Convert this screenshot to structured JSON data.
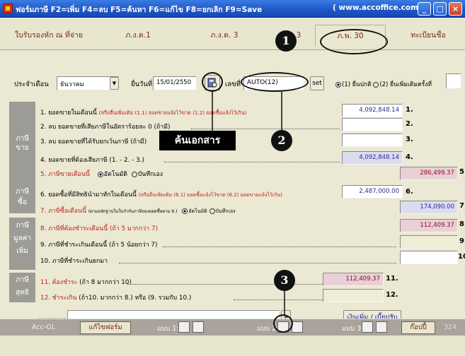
{
  "window": {
    "title": "ฟอร์มภาษี  F2=เพิ่ม F4=ลบ F5=ค้นหา F6=แก้ไข F8=ยกเลิก F9=Save",
    "url": "( www.accoffice.com )",
    "min": "_",
    "max": "□",
    "close": "×"
  },
  "tabs": [
    {
      "label": "ใบรับรองหัก ณ ที่จ่าย"
    },
    {
      "label": "ภ.ง.ด.1"
    },
    {
      "label": "ภ.ง.ด. 3"
    },
    {
      "label": "3"
    },
    {
      "label": "ภ.พ. 30"
    },
    {
      "label": "ทะเบียนชื่อ"
    }
  ],
  "header": {
    "month_label": "ประจำเดือน",
    "month_value": "ธันวาคม",
    "date_label": "ยื่นวันที่",
    "date_value": "15/01/2550",
    "no_label": "เลขที่",
    "no_value": "AUTO(12)",
    "set_label": "set",
    "filing_normal": "(1) ยื่นปกติ",
    "filing_extra": "(2) ยื่นเพิ่มเติมครั้งที่"
  },
  "sections": {
    "sales": "ภาษี\nขาย",
    "purchase": "ภาษี\nซื้อ",
    "vat": "ภาษี\nมูลค่า\nเพิ่ม",
    "net": "ภาษี\nสุทธิ"
  },
  "rows": {
    "r1": "1. ยอดขายในเดือนนี้",
    "r1_note": "(หรือยื่นเพิ่มเติม (1.1) ยอดขายแจ้งไว้ขาด (1.2) ยอดซื้อแจ้งไว้เกิน)",
    "r1_val": "4,092,848.14",
    "r1_no": "1.",
    "r2": "2. ลบ ยอดขายที่เสียภาษีในอัตราร้อยละ 0 (ถ้ามี)",
    "r2_no": "2.",
    "r3": "3. ลบ ยอดขายที่ได้รับยกเว้นภาษี (ถ้ามี)",
    "r3_no": "3.",
    "r4": "4. ยอดขายที่ต้องเสียภาษี (1. - 2. - 3.)",
    "r4_val": "4,092,848.14",
    "r4_no": "4.",
    "r5": "5. ภาษีขายเดือนนี้",
    "r5_auto": "อัตโนมัติ",
    "r5_manual": "บันทึกเอง",
    "r5_val": "286,499.37",
    "r5_no": "5.",
    "r6": "6. ยอดซื้อที่มีสิทธินำมาหักในเดือนนี้",
    "r6_note": "(หรือยื่นเพิ่มเติม (6.1) ยอดซื้อแจ้งไว้ขาด (6.2) ยอดขายแจ้งไว้เกิน)",
    "r6_val": "2,487,000.00",
    "r6_no": "6.",
    "r7": "7. ภาษีซื้อเดือนนี้",
    "r7_note": "(ตามหลักฐานในใบกำกับภาษีของยอดซื้อตาม 6.)",
    "r7_auto": "อัตโนมัติ",
    "r7_manual": "บันทึกเอง",
    "r7_val": "174,090.00",
    "r7_no": "7.",
    "r8": "8. ภาษีที่ต้องชำระเดือนนี้ (ถ้า 5 มากกว่า 7)",
    "r8_val": "112,409.37",
    "r8_no": "8.",
    "r9": "9. ภาษีที่ชำระเกินเดือนนี้ (ถ้า 5 น้อยกว่า 7)",
    "r9_no": "9.",
    "r10": "10. ภาษีที่ชำระเกินยกมา",
    "r10_no": "10",
    "r11a": "11. ต้องชำระ",
    "r11b": "(ถ้า 8 มากกว่า 10)",
    "r11_val": "112,409.37",
    "r11_no": "11.",
    "r12a": "12. ชำระเกิน",
    "r12b": "(ถ้า10. มากกว่า 8.) หรือ (9. รวมกับ 10.)",
    "r12_no": "12."
  },
  "search_doc": "ค้นเอกสาร",
  "remark_label": "หมายเหตุ",
  "surcharge_button": "เงินเพิ่ม / เบี้ยปรับ",
  "footer": {
    "app": "Acc-GL",
    "edit_form": "แก้ไขฟอร์ม",
    "form1": "แบบ 1:",
    "form2": "แบบ 2:",
    "form3": "แบบ 3:",
    "copy": "ก๊อปปี้",
    "page": "324"
  },
  "callouts": [
    "1",
    "2",
    "3"
  ]
}
